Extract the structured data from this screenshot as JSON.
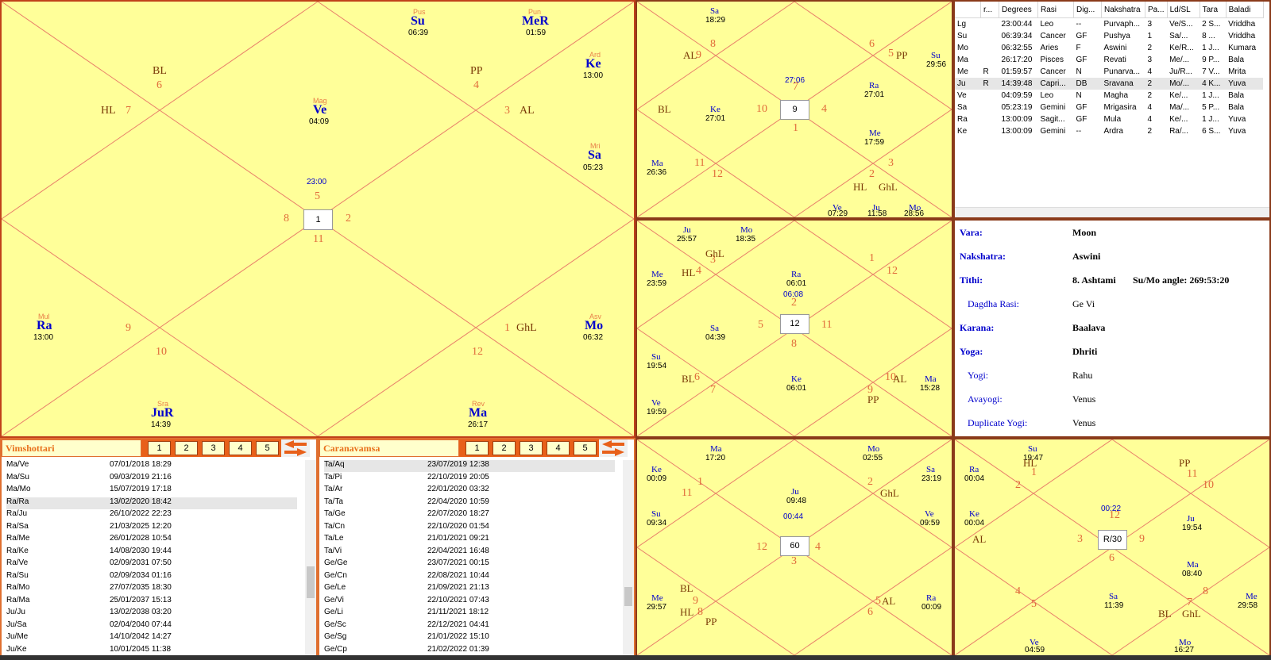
{
  "main_chart": {
    "center_degree": "23:00",
    "center_box": "1",
    "house_numbers": [
      "5",
      "4",
      "3",
      "2",
      "1",
      "12",
      "11",
      "10",
      "9",
      "8",
      "7",
      "6"
    ],
    "planets": [
      {
        "nak": "Pus",
        "name": "Su",
        "deg": "06:39"
      },
      {
        "nak": "Pun",
        "name": "MeR",
        "deg": "01:59"
      },
      {
        "nak": "Ard",
        "name": "Ke",
        "deg": "13:00"
      },
      {
        "nak": "Mag",
        "name": "Ve",
        "deg": "04:09"
      },
      {
        "nak": "Mri",
        "name": "Sa",
        "deg": "05:23"
      },
      {
        "nak": "Mul",
        "name": "Ra",
        "deg": "13:00"
      },
      {
        "nak": "Asv",
        "name": "Mo",
        "deg": "06:32"
      },
      {
        "nak": "Sra",
        "name": "JuR",
        "deg": "14:39"
      },
      {
        "nak": "Rev",
        "name": "Ma",
        "deg": "26:17"
      }
    ],
    "special": [
      "BL",
      "HL",
      "PP",
      "AL",
      "GhL"
    ]
  },
  "chart_d9": {
    "center_box": "9",
    "center_degree": "27:06",
    "houses": [
      "7",
      "6",
      "5",
      "4",
      "3",
      "2",
      "1",
      "12",
      "11",
      "10",
      "9",
      "8"
    ],
    "planets": [
      [
        "Sa",
        "18:29"
      ],
      [
        "Su",
        "29:56"
      ],
      [
        "Ke",
        "27:01"
      ],
      [
        "Ra",
        "27:01"
      ],
      [
        "Me",
        "17:59"
      ],
      [
        "Ma",
        "26:36"
      ],
      [
        "Ve",
        "07:29"
      ],
      [
        "Ju",
        "11:58"
      ],
      [
        "Mo",
        "28:56"
      ]
    ],
    "special": [
      "AL",
      "PP",
      "BL",
      "HL",
      "GhL"
    ]
  },
  "chart_d3": {
    "center_box": "12",
    "center_degree": "06:08",
    "houses": [
      "2",
      "1",
      "12",
      "11",
      "10",
      "9",
      "8",
      "7",
      "6",
      "5",
      "4",
      "3"
    ],
    "planets": [
      [
        "Ju",
        "25:57"
      ],
      [
        "Mo",
        "18:35"
      ],
      [
        "Me",
        "23:59"
      ],
      [
        "Ra",
        "06:01"
      ],
      [
        "Sa",
        "04:39"
      ],
      [
        "Su",
        "19:54"
      ],
      [
        "Ke",
        "06:01"
      ],
      [
        "Ma",
        "15:28"
      ],
      [
        "Ve",
        "19:59"
      ]
    ],
    "special": [
      "GhL",
      "HL",
      "BL",
      "AL",
      "PP"
    ]
  },
  "chart_d60": {
    "center_box": "60",
    "center_degree": "00:44",
    "houses": [
      "3",
      "2",
      "1",
      "12",
      "11",
      "10",
      "9",
      "8",
      "7",
      "6",
      "5",
      "4"
    ],
    "planets": [
      [
        "Ma",
        "17:20"
      ],
      [
        "Mo",
        "02:55"
      ],
      [
        "Ke",
        "00:09"
      ],
      [
        "Sa",
        "23:19"
      ],
      [
        "Ju",
        "09:48"
      ],
      [
        "Su",
        "09:34"
      ],
      [
        "Ve",
        "09:59"
      ],
      [
        "Me",
        "29:57"
      ],
      [
        "Ra",
        "00:09"
      ]
    ],
    "special": [
      "GhL",
      "BL",
      "HL",
      "PP",
      "AL"
    ]
  },
  "chart_r30": {
    "center_box": "R/30",
    "center_degree": "00:22",
    "houses": [
      "1",
      "11",
      "10",
      "9",
      "8",
      "7",
      "6",
      "5",
      "4",
      "3",
      "2",
      "12"
    ],
    "planets": [
      [
        "Su",
        "19:47"
      ],
      [
        "Ra",
        "00:04"
      ],
      [
        "Ke",
        "00:04"
      ],
      [
        "Ju",
        "19:54"
      ],
      [
        "Ma",
        "08:40"
      ],
      [
        "Sa",
        "11:39"
      ],
      [
        "Me",
        "29:58"
      ],
      [
        "Ve",
        "04:59"
      ],
      [
        "Mo",
        "16:27"
      ]
    ],
    "special": [
      "HL",
      "PP",
      "AL",
      "BL",
      "GhL"
    ]
  },
  "table": {
    "headers": [
      "",
      "r...",
      "Degrees",
      "Rasi",
      "Dig...",
      "Nakshatra",
      "Pa...",
      "Ld/SL",
      "Tara",
      "Baladi"
    ],
    "rows": [
      [
        "Lg",
        "",
        "23:00:44",
        "Leo",
        "--",
        "Purvaph...",
        "3",
        "Ve/S...",
        "2 S...",
        "Vriddha"
      ],
      [
        "Su",
        "",
        "06:39:34",
        "Cancer",
        "GF",
        "Pushya",
        "1",
        "Sa/...",
        "8 ...",
        "Vriddha"
      ],
      [
        "Mo",
        "",
        "06:32:55",
        "Aries",
        "F",
        "Aswini",
        "2",
        "Ke/R...",
        "1 J...",
        "Kumara"
      ],
      [
        "Ma",
        "",
        "26:17:20",
        "Pisces",
        "GF",
        "Revati",
        "3",
        "Me/...",
        "9 P...",
        "Bala"
      ],
      [
        "Me",
        "R",
        "01:59:57",
        "Cancer",
        "N",
        "Punarva...",
        "4",
        "Ju/R...",
        "7 V...",
        "Mrita"
      ],
      [
        "Ju",
        "R",
        "14:39:48",
        "Capri...",
        "DB",
        "Sravana",
        "2",
        "Mo/...",
        "4 K...",
        "Yuva"
      ],
      [
        "Ve",
        "",
        "04:09:59",
        "Leo",
        "N",
        "Magha",
        "2",
        "Ke/...",
        "1 J...",
        "Bala"
      ],
      [
        "Sa",
        "",
        "05:23:19",
        "Gemini",
        "GF",
        "Mrigasira",
        "4",
        "Ma/...",
        "5 P...",
        "Bala"
      ],
      [
        "Ra",
        "",
        "13:00:09",
        "Sagit...",
        "GF",
        "Mula",
        "4",
        "Ke/...",
        "1 J...",
        "Yuva"
      ],
      [
        "Ke",
        "",
        "13:00:09",
        "Gemini",
        "--",
        "Ardra",
        "2",
        "Ra/...",
        "6 S...",
        "Yuva"
      ]
    ]
  },
  "panchang": {
    "vara_k": "Vara:",
    "vara_v": "Moon",
    "nak_k": "Nakshatra:",
    "nak_v": "Aswini",
    "tithi_k": "Tithi:",
    "tithi_v": "8. Ashtami",
    "tithi_extra": "Su/Mo angle: 269:53:20",
    "dagdha_k": "Dagdha Rasi:",
    "dagdha_v": "Ge  Vi",
    "karana_k": "Karana:",
    "karana_v": "Baalava",
    "yoga_k": "Yoga:",
    "yoga_v": "Dhriti",
    "yogi_k": "Yogi:",
    "yogi_v": "Rahu",
    "avayogi_k": "Avayogi:",
    "avayogi_v": "Venus",
    "dupyogi_k": "Duplicate Yogi:",
    "dupyogi_v": "Venus"
  },
  "vimshottari": {
    "title": "Vimshottari",
    "tabs": [
      "1",
      "2",
      "3",
      "4",
      "5"
    ],
    "rows": [
      [
        "Ma/Ve",
        "07/01/2018  18:29"
      ],
      [
        "Ma/Su",
        "09/03/2019  21:16"
      ],
      [
        "Ma/Mo",
        "15/07/2019  17:18"
      ],
      [
        "Ra/Ra",
        "13/02/2020  18:42"
      ],
      [
        "Ra/Ju",
        "26/10/2022  22:23"
      ],
      [
        "Ra/Sa",
        "21/03/2025  12:20"
      ],
      [
        "Ra/Me",
        "26/01/2028  10:54"
      ],
      [
        "Ra/Ke",
        "14/08/2030  19:44"
      ],
      [
        "Ra/Ve",
        "02/09/2031  07:50"
      ],
      [
        "Ra/Su",
        "02/09/2034  01:16"
      ],
      [
        "Ra/Mo",
        "27/07/2035  18:30"
      ],
      [
        "Ra/Ma",
        "25/01/2037  15:13"
      ],
      [
        "Ju/Ju",
        "13/02/2038  03:20"
      ],
      [
        "Ju/Sa",
        "02/04/2040  07:44"
      ],
      [
        "Ju/Me",
        "14/10/2042  14:27"
      ],
      [
        "Ju/Ke",
        "10/01/2045  11:38"
      ]
    ],
    "selected": 3
  },
  "caranavamsa": {
    "title": "Caranavamsa",
    "tabs": [
      "1",
      "2",
      "3",
      "4",
      "5"
    ],
    "rows": [
      [
        "Ta/Aq",
        "23/07/2019  12:38"
      ],
      [
        "Ta/Pi",
        "22/10/2019  20:05"
      ],
      [
        "Ta/Ar",
        "22/01/2020  03:32"
      ],
      [
        "Ta/Ta",
        "22/04/2020  10:59"
      ],
      [
        "Ta/Ge",
        "22/07/2020  18:27"
      ],
      [
        "Ta/Cn",
        "22/10/2020  01:54"
      ],
      [
        "Ta/Le",
        "21/01/2021  09:21"
      ],
      [
        "Ta/Vi",
        "22/04/2021  16:48"
      ],
      [
        "Ge/Ge",
        "23/07/2021  00:15"
      ],
      [
        "Ge/Cn",
        "22/08/2021  10:44"
      ],
      [
        "Ge/Le",
        "21/09/2021  21:13"
      ],
      [
        "Ge/Vi",
        "22/10/2021  07:43"
      ],
      [
        "Ge/Li",
        "21/11/2021  18:12"
      ],
      [
        "Ge/Sc",
        "22/12/2021  04:41"
      ],
      [
        "Ge/Sg",
        "21/01/2022  15:10"
      ],
      [
        "Ge/Cp",
        "21/02/2022  01:39"
      ]
    ],
    "selected": 0
  }
}
